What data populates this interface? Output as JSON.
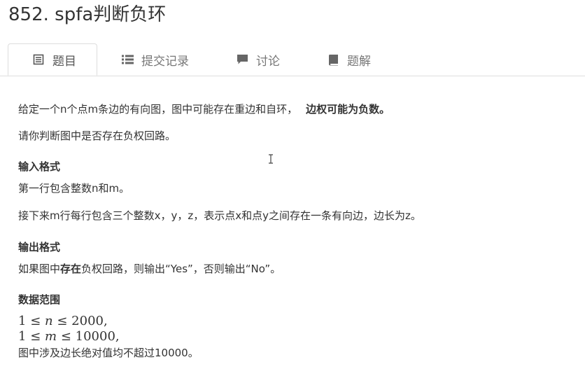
{
  "page": {
    "title": "852. spfa判断负环"
  },
  "tabs": [
    {
      "label": "题目",
      "icon": "document-icon",
      "active": true
    },
    {
      "label": "提交记录",
      "icon": "list-icon",
      "active": false
    },
    {
      "label": "讨论",
      "icon": "comment-icon",
      "active": false
    },
    {
      "label": "题解",
      "icon": "book-icon",
      "active": false
    }
  ],
  "problem": {
    "intro_normal": "给定一个n个点m条边的有向图，图中可能存在重边和自环，",
    "intro_bold": "边权可能为负数",
    "intro_end": "。",
    "task": "请你判断图中是否存在负权回路。",
    "input_heading": "输入格式",
    "input_line1": "第一行包含整数n和m。",
    "input_line2": "接下来m行每行包含三个整数x，y，z，表示点x和点y之间存在一条有向边，边长为z。",
    "output_heading": "输出格式",
    "output_pre": "如果图中",
    "output_bold": "存在",
    "output_post": "负权回路，则输出“Yes”，否则输出“No”。",
    "range_heading": "数据范围",
    "range_n": {
      "lhs": "1",
      "op1": "≤",
      "var": "n",
      "op2": "≤",
      "rhs": "2000",
      "end": ","
    },
    "range_m": {
      "lhs": "1",
      "op1": "≤",
      "var": "m",
      "op2": "≤",
      "rhs": "10000",
      "end": ","
    },
    "range_note": "图中涉及边长绝对值均不超过10000。"
  }
}
